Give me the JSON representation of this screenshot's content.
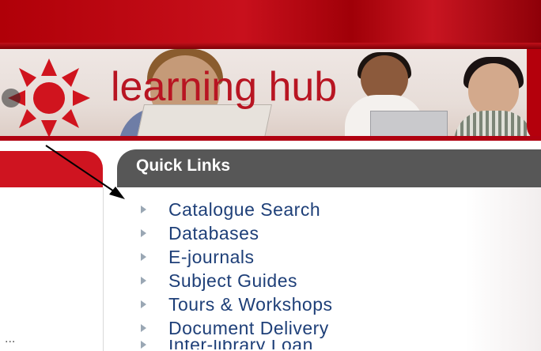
{
  "banner": {
    "brand_text": "learning hub",
    "colors": {
      "red": "#c8101c",
      "dark_red": "#8e0008",
      "banner_bg": "#ebe2de"
    }
  },
  "left_column": {
    "truncated_text": "..."
  },
  "quick_links": {
    "title": "Quick Links",
    "items": [
      {
        "label": "Catalogue Search"
      },
      {
        "label": "Databases"
      },
      {
        "label": "E-journals"
      },
      {
        "label": "Subject Guides"
      },
      {
        "label": "Tours & Workshops"
      },
      {
        "label": "Document Delivery"
      },
      {
        "label": "Inter-library Loan"
      }
    ],
    "colors": {
      "header_bg": "#575757",
      "link": "#1e3f78",
      "bullet": "#9aa7b4"
    }
  },
  "annotation": {
    "icon": "arrow-pointer-icon"
  }
}
